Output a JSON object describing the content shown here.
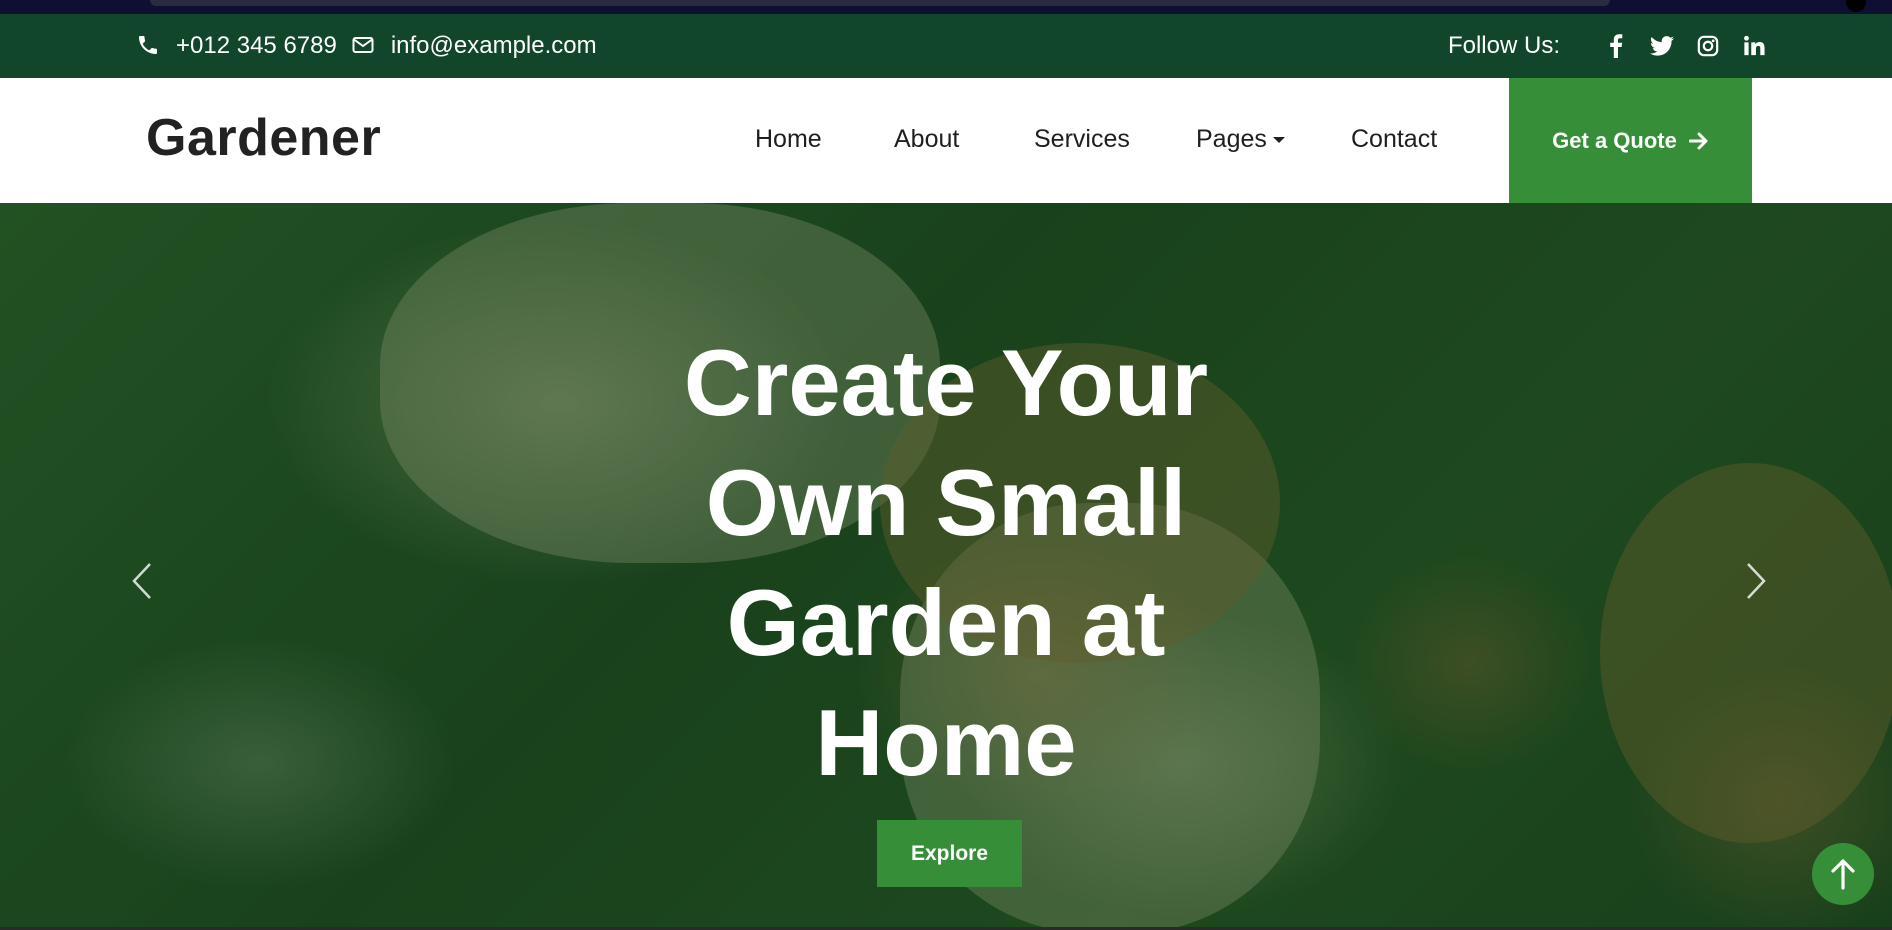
{
  "topbar": {
    "phone": "+012 345 6789",
    "email": "info@example.com",
    "follow_label": "Follow Us:",
    "social_icons": [
      "facebook-icon",
      "twitter-icon",
      "instagram-icon",
      "linkedin-icon"
    ]
  },
  "navbar": {
    "brand": "Gardener",
    "items": [
      {
        "label": "Home"
      },
      {
        "label": "About"
      },
      {
        "label": "Services"
      },
      {
        "label": "Pages",
        "has_dropdown": true
      },
      {
        "label": "Contact"
      }
    ],
    "cta_label": "Get a Quote"
  },
  "hero": {
    "headline": "Create Your Own Small Garden at Home",
    "button_label": "Explore"
  },
  "colors": {
    "topbar_bg": "#12462b",
    "accent_green": "#368e38",
    "text_dark": "#1f1f1f",
    "white": "#ffffff"
  }
}
